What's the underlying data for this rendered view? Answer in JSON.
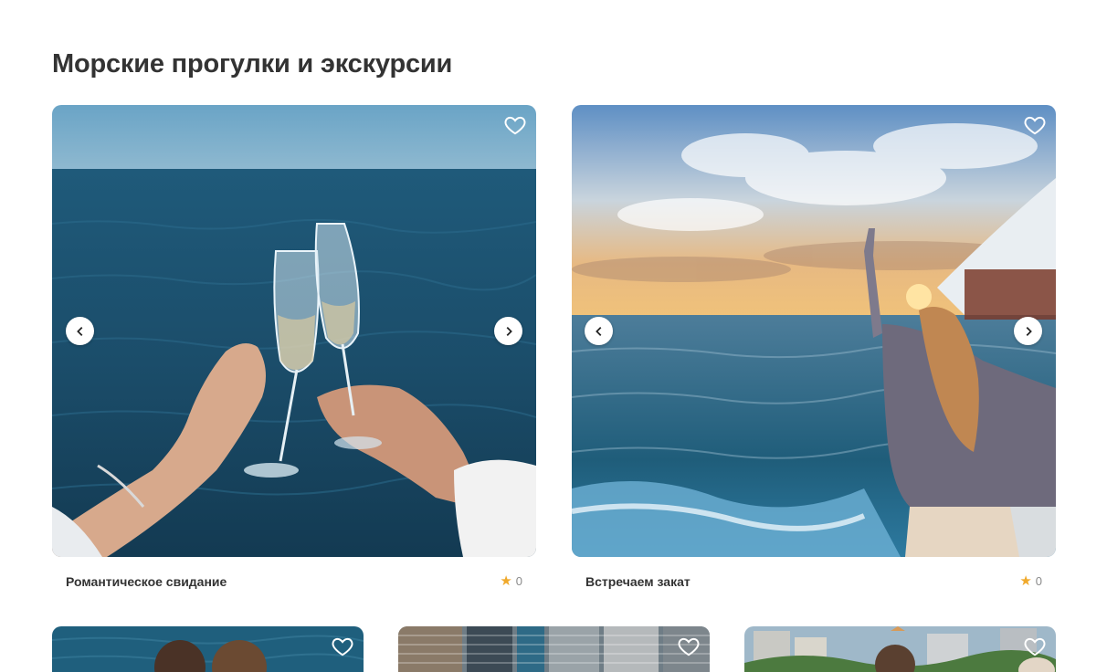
{
  "section": {
    "title": "Морские прогулки и экскурсии"
  },
  "cards_row1": [
    {
      "title": "Романтическое свидание",
      "rating": "0"
    },
    {
      "title": "Встречаем закат",
      "rating": "0"
    }
  ],
  "icons": {
    "favorite": "heart-outline-icon",
    "prev": "chevron-left-icon",
    "next": "chevron-right-icon",
    "rating": "star-icon"
  },
  "colors": {
    "star": "#f0a92b",
    "title": "#333333",
    "rating_text": "#8a8a8a"
  }
}
